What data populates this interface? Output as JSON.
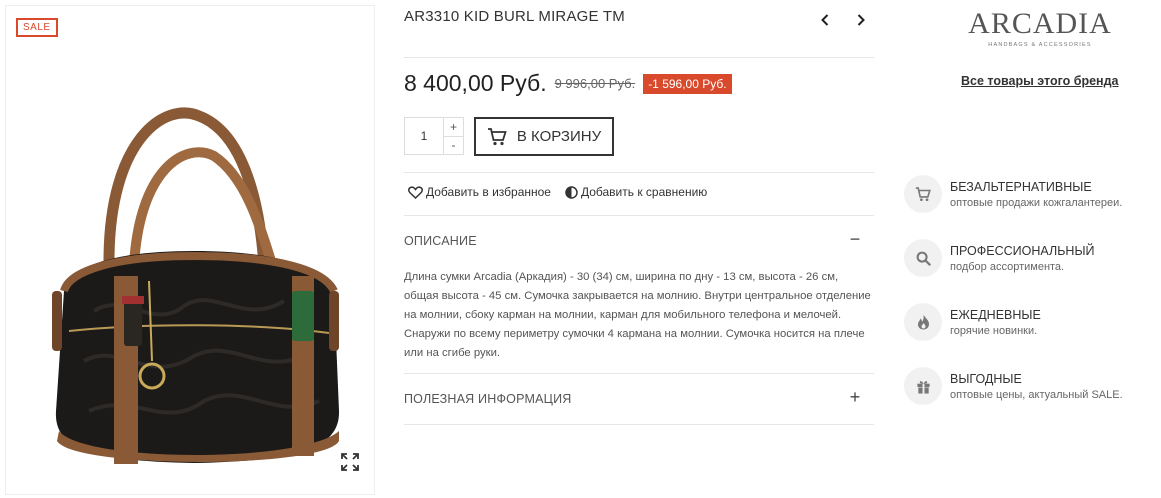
{
  "image": {
    "sale_badge": "SALE"
  },
  "product": {
    "title": "AR3310 KID BURL MIRAGE TM",
    "price": "8 400,00 Руб.",
    "old_price": "9 996,00 Руб.",
    "discount": "-1 596,00 Руб.",
    "quantity": "1",
    "qty_plus": "+",
    "qty_minus": "-",
    "cart_label": "В КОРЗИНУ",
    "favorites_label": "Добавить в избранное",
    "compare_label": "Добавить к сравнению"
  },
  "accordion": {
    "description": {
      "title": "ОПИСАНИЕ",
      "toggle": "−",
      "text": "Длина сумки Arcadia (Аркадия)  - 30 (34) см, ширина по дну - 13 см, высота - 26 см, общая высота - 45  см. Сумочка закрывается на молнию. Внутри центральное отделение на молнии, сбоку карман на молнии, карман для мобильного телефона и мелочей. Снаружи по всему периметру сумочки 4 кармана на молнии. Сумочка носится на плече или на сгибе руки."
    },
    "useful": {
      "title": "ПОЛЕЗНАЯ ИНФОРМАЦИЯ",
      "toggle": "+"
    }
  },
  "brand": {
    "name": "ARCADIA",
    "subtitle": "HANDBAGS & ACCESSORIES",
    "link": "Все товары этого бренда"
  },
  "features": [
    {
      "icon": "cart-icon",
      "title": "БЕЗАЛЬТЕРНАТИВНЫЕ",
      "subtitle": "оптовые продажи кожгалантереи."
    },
    {
      "icon": "search-icon",
      "title": "ПРОФЕССИОНАЛЬНЫЙ",
      "subtitle": "подбор ассортимента."
    },
    {
      "icon": "fire-icon",
      "title": "ЕЖЕДНЕВНЫЕ",
      "subtitle": "горячие новинки."
    },
    {
      "icon": "gift-icon",
      "title": "ВЫГОДНЫЕ",
      "subtitle": "оптовые цены, актуальный SALE."
    }
  ],
  "colors": {
    "accent": "#d9492b",
    "text": "#333333",
    "bag_body": "#1c1a18",
    "bag_leather": "#8a5a36"
  }
}
